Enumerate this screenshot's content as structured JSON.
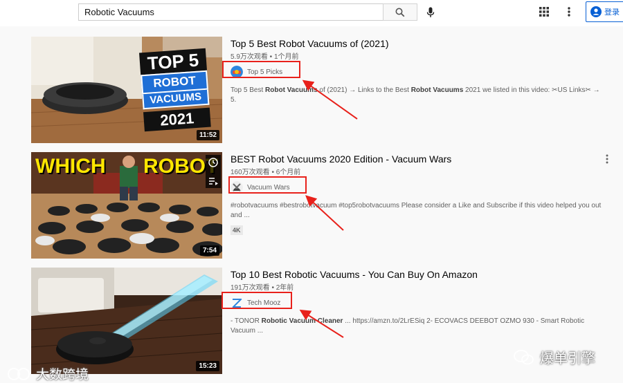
{
  "search": {
    "value": "Robotic Vacuums"
  },
  "header": {
    "login_label": "登录"
  },
  "videos": [
    {
      "title": "Top 5 Best Robot Vacuums of (2021)",
      "meta": "5.9万次观看 • 1个月前",
      "channel": "Top 5 Picks",
      "description_pre": "Top 5 Best ",
      "description_bold": "Robot Vacuums",
      "description_post": " of (2021) → Links to the Best ",
      "description_bold2": "Robot Vacuums",
      "description_post2": " 2021 we listed in this video: ✂US Links✂ → 5.",
      "duration": "11:52",
      "thumb_text": [
        "TOP 5",
        "ROBOT",
        "VACUUMS",
        "2021"
      ]
    },
    {
      "title": "BEST Robot Vacuums 2020 Edition - Vacuum Wars",
      "meta": "160万次观看 • 6个月前",
      "channel": "Vacuum Wars",
      "description": "#robotvacuums #bestrobotvacuum #top5robotvacuums Please consider a Like and Subscribe if this video helped you out and ...",
      "badge": "4K",
      "duration": "7:54",
      "thumb_text": [
        "WHICH",
        "ROBOT"
      ]
    },
    {
      "title": "Top 10 Best Robotic Vacuums - You Can Buy On Amazon",
      "meta": "191万次观看 • 2年前",
      "channel": "Tech Mooz",
      "description_pre": "- TONOR ",
      "description_bold": "Robotic Vacuum Cleaner",
      "description_post": " ... https://amzn.to/2LrESiq 2- ECOVACS DEEBOT OZMO 930 - Smart Robotic Vacuum ...",
      "duration": "15:23"
    }
  ],
  "watermarks": {
    "left": "大数跨境",
    "right": "爆单引擎"
  },
  "colors": {
    "accent": "#065fd4",
    "highlight": "#e8211b"
  }
}
